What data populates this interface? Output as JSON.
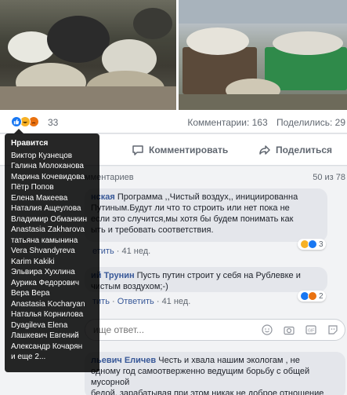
{
  "post": {
    "reactions_count": "33",
    "comments_stat": "Комментарии: 163",
    "shares_stat": "Поделились: 29"
  },
  "reactions": [
    "like-icon",
    "haha-icon",
    "angry-icon"
  ],
  "actions": {
    "comment_label": "Комментировать",
    "share_label": "Поделиться"
  },
  "comments_header": {
    "label": "мментариев",
    "count": "50 из 78"
  },
  "comments": [
    {
      "author": "нская",
      "text_after": " Программа ,,Чистый воздух,, инициированна",
      "line2": "Путиным.Будут ли что то строить или нет пока не",
      "line3": "если это случится,мы хотя бы будем понимать как",
      "line4": "ыть и требовать соответствия.",
      "meta_reply": "етить",
      "meta_time": "· 41 нед.",
      "reaction_count": "3"
    },
    {
      "author": "ий Трунин",
      "text_after": " Пусть путин строит у себя на Рублевке и",
      "line2": "чистым воздухом;-)",
      "meta_reply": "тить",
      "meta_answer": "Ответить",
      "meta_time": "· 41 нед.",
      "reaction_count": "2"
    },
    {
      "author": "льевич Еличев",
      "text_after": " Честь и хвала нашим экологам , не",
      "line2": "одному год самоотверженно ведущим борьбу с общей мусорной",
      "line3": "бедой, зарабатывая при этом никак не доброе отношение"
    }
  ],
  "reply_box": {
    "placeholder": "ище ответ..."
  },
  "tooltip": {
    "title": "Нравится",
    "names": [
      "Виктор Кузнецов",
      "Галина Молоканова",
      "Марина Кочевидова",
      "Пётр Попов",
      "Елена Макеева",
      "Наталия Ащеулова",
      "Владимир Обманкин",
      "Anastasia Zakharova",
      "татьяна камынина",
      "Vera Shvandyreva",
      "Karim Kakiki",
      "Эльвира Хухлина",
      "Аурика Федорович",
      "Вера Вера",
      "Anastasia Kocharyan",
      "Наталья Корнилова",
      "Dyagileva Elena",
      "Лашкевич Евгений",
      "Александр Кочарян",
      "и еще 2..."
    ]
  },
  "colors": {
    "link": "#385898",
    "like": "#1877f2",
    "haha": "#f7b125",
    "angry": "#e9710f"
  }
}
